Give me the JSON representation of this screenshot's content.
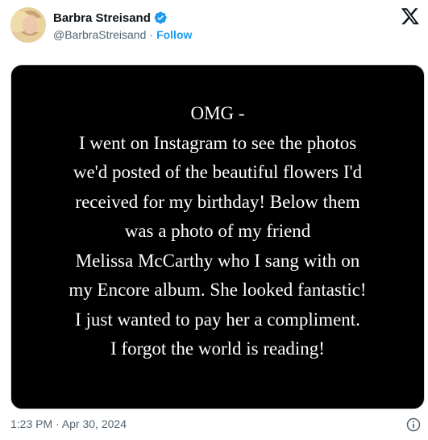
{
  "post": {
    "author_name": "Barbra Streisand",
    "author_handle": "@BarbraStreisand",
    "separator": "·",
    "follow_label": "Follow",
    "verified": true,
    "timestamp": "1:23 PM · Apr 30, 2024"
  },
  "note_image": {
    "lines": [
      "OMG -",
      "I went on Instagram to see the photos",
      "we'd posted of the beautiful flowers I'd",
      "received for my birthday!  Below them",
      "was a photo of my friend",
      "Melissa McCarthy who I sang with on",
      "my Encore album.  She looked fantastic!",
      "I just wanted to pay her a compliment.",
      "I forgot the world is reading!"
    ]
  },
  "colors": {
    "follow": "#1d9bf0",
    "verified_badge": "#1d9bf0",
    "muted_text": "#536471",
    "note_background": "#000000",
    "note_text": "#ffffff"
  },
  "icons": [
    "verified-badge-icon",
    "x-logo-icon",
    "info-icon"
  ]
}
